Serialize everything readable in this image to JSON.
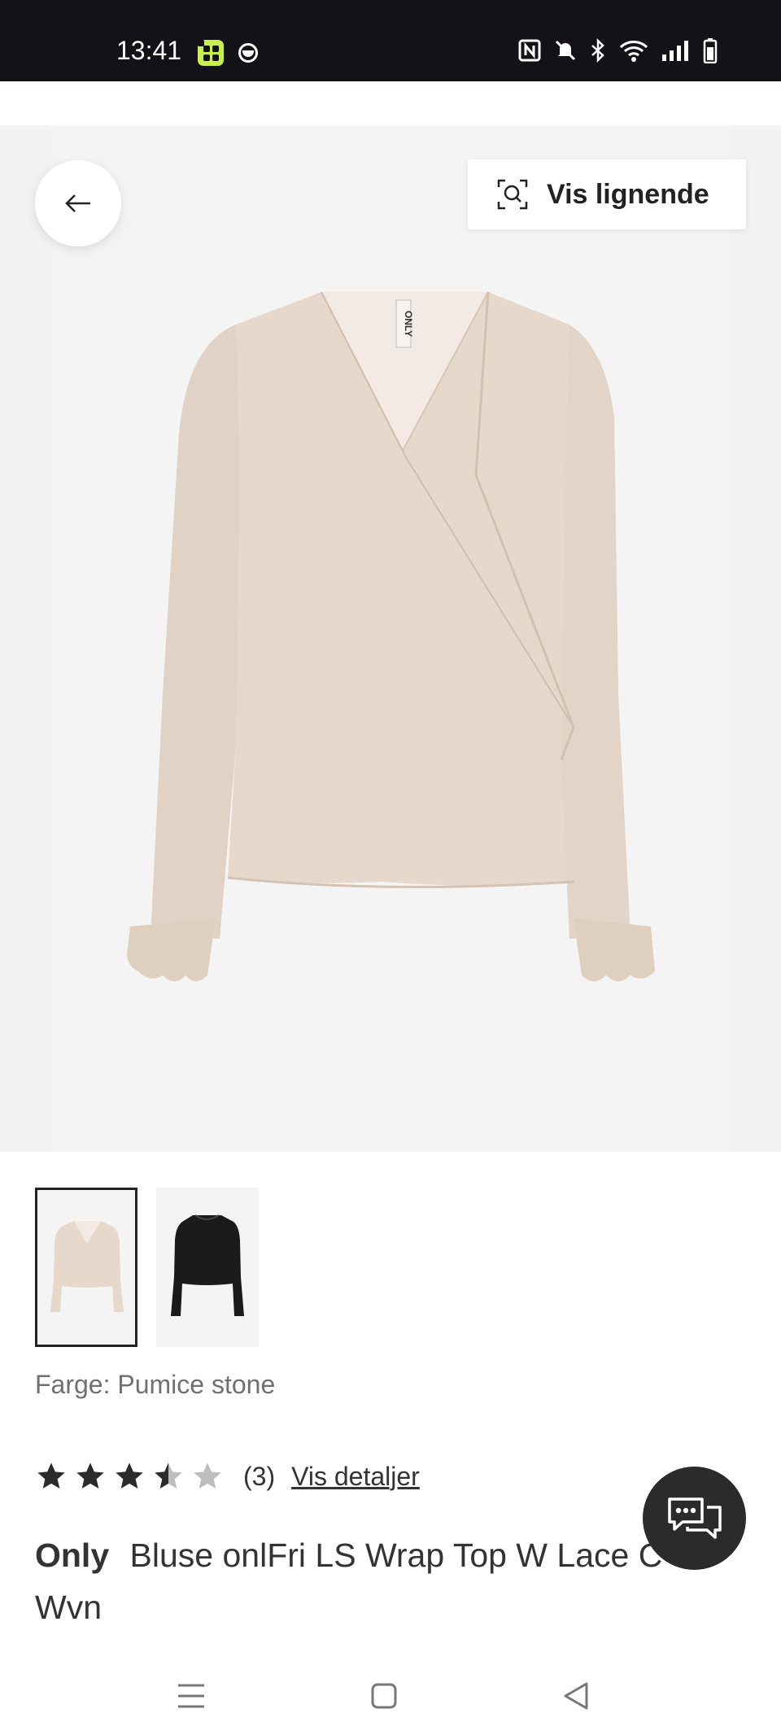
{
  "status_bar": {
    "time": "13:41",
    "icons": [
      "app-grid-icon",
      "moon-icon",
      "nfc-icon",
      "mute-icon",
      "bluetooth-icon",
      "wifi-icon",
      "signal-icon",
      "battery-icon"
    ]
  },
  "hero": {
    "similar_button_label": "Vis lignende",
    "back_icon": "arrow-left-icon",
    "similar_icon": "visual-search-icon"
  },
  "thumbnails": [
    {
      "name": "pumice-stone",
      "selected": true,
      "color": "#e6d9cc"
    },
    {
      "name": "black",
      "selected": false,
      "color": "#1a1a1a"
    }
  ],
  "product": {
    "color_label": "Farge: Pumice stone",
    "rating_value": 3.5,
    "rating_max": 5,
    "rating_count": "(3)",
    "details_link": "Vis detaljer",
    "brand": "Only",
    "name": "Bluse onlFri LS Wrap Top W Lace C Wvn"
  },
  "colors": {
    "accent_dark": "#2b2b2b",
    "blouse": "#e6d9cc"
  }
}
